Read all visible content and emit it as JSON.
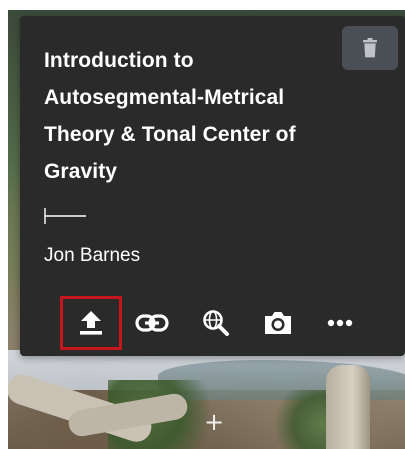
{
  "card": {
    "title": "Introduction to Autosegmental-Metrical Theory & Tonal Center of Gravity",
    "author": "Jon Barnes"
  },
  "toolbar": {
    "items": [
      {
        "icon": "upload-icon",
        "selected": true
      },
      {
        "icon": "link-icon"
      },
      {
        "icon": "search-globe-icon"
      },
      {
        "icon": "camera-icon"
      },
      {
        "icon": "more-horizontal-icon"
      }
    ]
  },
  "header_actions": {
    "delete_icon": "trash-icon"
  },
  "overlay": {
    "add_icon": "plus-icon",
    "add_glyph": "+"
  },
  "colors": {
    "card_bg": "#2a2a2a",
    "text": "#ffffff",
    "trash_button_bg": "#4a4f56",
    "selection_outline": "#c4161c"
  }
}
